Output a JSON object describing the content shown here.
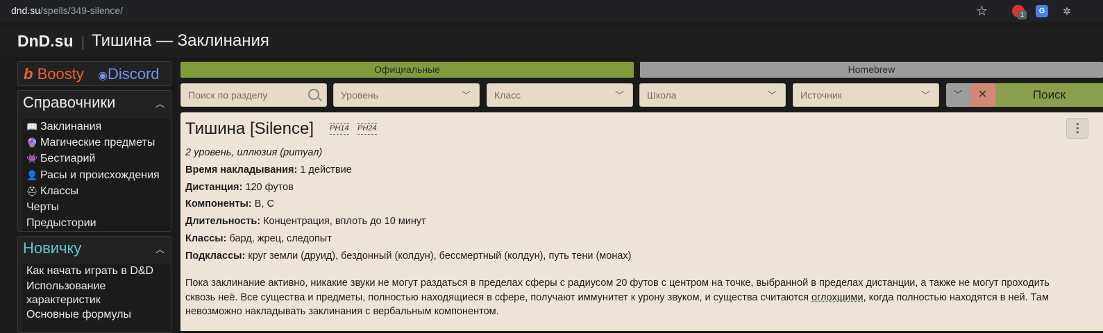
{
  "browser": {
    "url_host": "dnd.su",
    "url_path": "/spells/349-silence/",
    "ext_badge": "1",
    "ext_translate": "G"
  },
  "header": {
    "logo": "DnD.su",
    "title": "Тишина — Заклинания"
  },
  "donate": {
    "boosty": "Boosty",
    "discord": "Discord"
  },
  "sidebar": {
    "reference": {
      "title": "Справочники",
      "items": [
        {
          "label": "Заклинания",
          "icon": "book-icon"
        },
        {
          "label": "Магические предметы",
          "icon": "crystal-ball-icon"
        },
        {
          "label": "Бестиарий",
          "icon": "monster-icon"
        },
        {
          "label": "Расы и происхождения",
          "icon": "person-icon"
        },
        {
          "label": "Классы",
          "icon": "helmet-icon"
        },
        {
          "label": "Черты",
          "icon": ""
        },
        {
          "label": "Предыстории",
          "icon": ""
        }
      ]
    },
    "newbie": {
      "title": "Новичку",
      "items": [
        {
          "label": "Как начать играть в D&D"
        },
        {
          "label": "Использование характеристик"
        },
        {
          "label": "Основные формулы"
        }
      ]
    }
  },
  "filters": {
    "tab_official": "Официальные",
    "tab_homebrew": "Homebrew",
    "search_placeholder": "Поиск по разделу",
    "level": "Уровень",
    "class": "Класс",
    "school": "Школа",
    "source": "Источник",
    "search_button": "Поиск"
  },
  "spell": {
    "title": "Тишина [Silence]",
    "sources": [
      "PH14",
      "PH24"
    ],
    "level_line": "2 уровень, иллюзия (ритуал)",
    "fields": [
      {
        "label": "Время накладывания:",
        "value": " 1 действие"
      },
      {
        "label": "Дистанция:",
        "value": " 120 футов"
      },
      {
        "label": "Компоненты:",
        "value": " В, С"
      },
      {
        "label": "Длительность:",
        "value": " Концентрация, вплоть до 10 минут"
      },
      {
        "label": "Классы:",
        "value": " бард, жрец, следопыт"
      },
      {
        "label": "Подклассы:",
        "value": " круг земли (друид), бездонный (колдун), бессмертный (колдун), путь тени (монах)"
      }
    ],
    "description_before": "Пока заклинание активно, никакие звуки не могут раздаться в пределах сферы с радиусом 20 футов с центром на точке, выбранной в пределах дистанции, а также не могут проходить сквозь неё. Все существа и предметы, полностью находящиеся в сфере, получают иммунитет к урону звуком, и существа считаются ",
    "description_link": "оглохшими",
    "description_after": ", когда полностью находятся в ней. Там невозможно накладывать заклинания с вербальным компонентом."
  }
}
